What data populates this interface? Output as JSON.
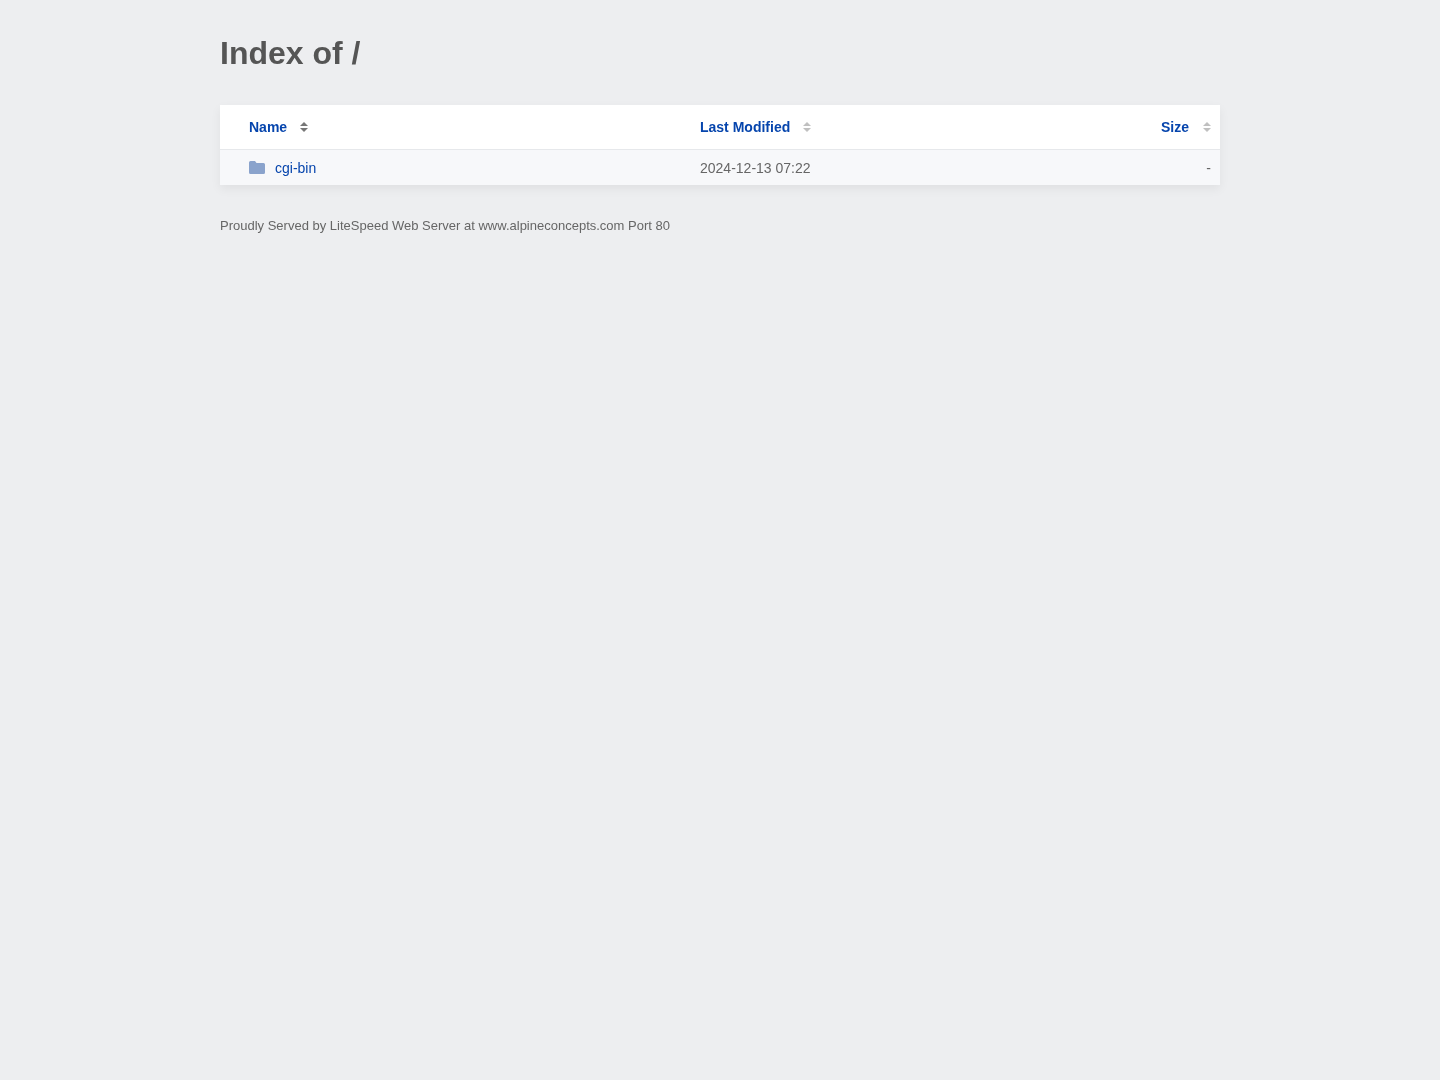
{
  "title": "Index of /",
  "columns": [
    {
      "label": "Name",
      "sorted": true
    },
    {
      "label": "Last Modified",
      "sorted": false
    },
    {
      "label": "Size",
      "sorted": false
    }
  ],
  "rows": [
    {
      "kind": "folder",
      "name": "cgi-bin",
      "modified": "2024-12-13 07:22",
      "size": "-"
    }
  ],
  "footer": "Proudly Served by LiteSpeed Web Server at www.alpineconcepts.com Port 80"
}
